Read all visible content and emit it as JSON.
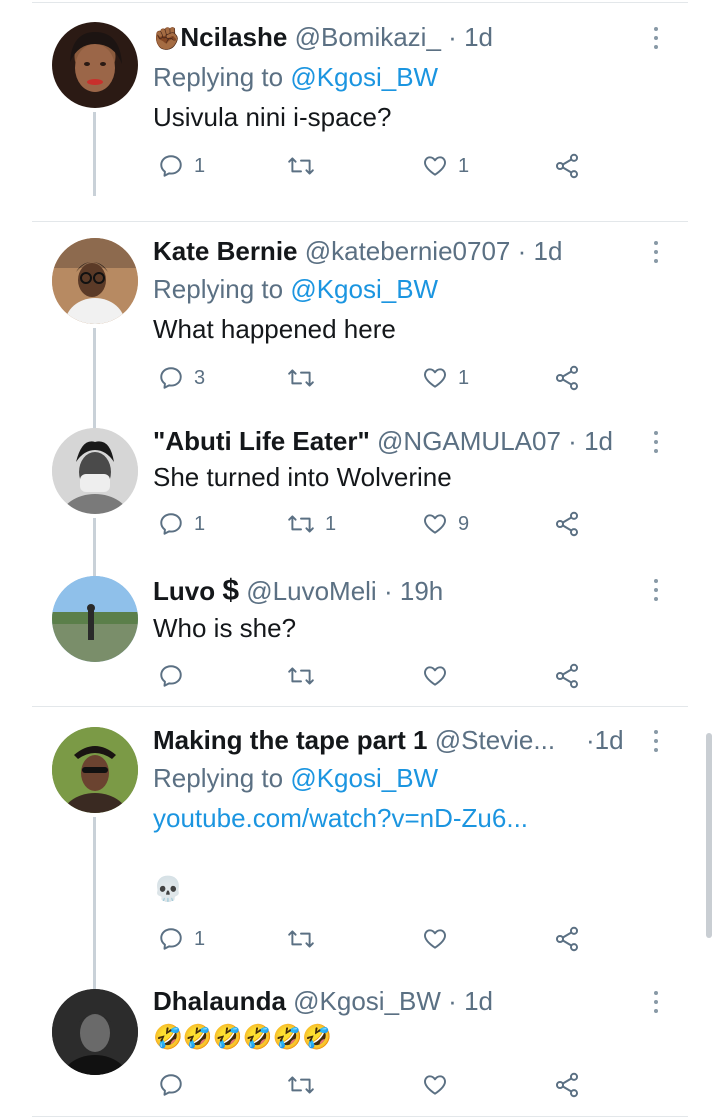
{
  "tweets": [
    {
      "name": "Ncilashe",
      "name_prefix_emoji": "✊🏾",
      "handle": "@Bomikazi_",
      "time": "1d",
      "replying_label": "Replying to",
      "replying_to": "@Kgosi_BW",
      "text": "Usivula nini i-space?",
      "replies": "1",
      "retweets": "",
      "likes": "1"
    },
    {
      "name": "Kate Bernie",
      "handle": "@katebernie0707",
      "time": "1d",
      "replying_label": "Replying to",
      "replying_to": "@Kgosi_BW",
      "text": "What happened here",
      "replies": "3",
      "retweets": "",
      "likes": "1"
    },
    {
      "name": "\"Abuti Life Eater\"",
      "handle": "@NGAMULA07",
      "time": "1d",
      "text": "She turned into Wolverine",
      "replies": "1",
      "retweets": "1",
      "likes": "9"
    },
    {
      "name": "Luvo",
      "name_suffix": "$",
      "handle": "@LuvoMeli",
      "time": "19h",
      "text": "Who is she?",
      "replies": "",
      "retweets": "",
      "likes": ""
    },
    {
      "name": "Making the tape part 1",
      "handle": "@Stevie...",
      "time": "1d",
      "replying_label": "Replying to",
      "replying_to": "@Kgosi_BW",
      "link": "youtube.com/watch?v=nD-Zu6...",
      "emoji_line": "💀",
      "replies": "1",
      "retweets": "",
      "likes": ""
    },
    {
      "name": "Dhalaunda",
      "handle": "@Kgosi_BW",
      "time": "1d",
      "text": "🤣🤣🤣🤣🤣🤣",
      "replies": "",
      "retweets": "",
      "likes": ""
    }
  ],
  "separator": "·",
  "colors": {
    "accent": "#1b95e0",
    "secondary_text": "#5b7083",
    "primary_text": "#14171a",
    "thread_line": "#c9d1d8"
  },
  "icons": [
    "reply-icon",
    "retweet-icon",
    "like-icon",
    "share-icon",
    "more-icon"
  ]
}
